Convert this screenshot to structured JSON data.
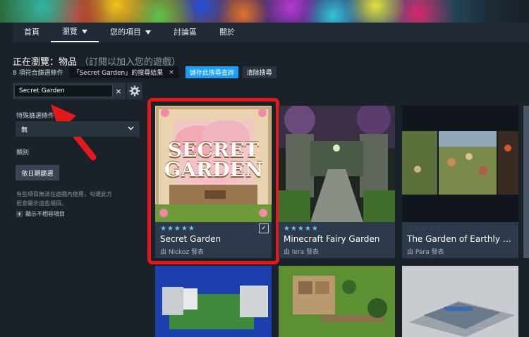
{
  "nav": {
    "items": [
      {
        "label": "首頁"
      },
      {
        "label": "瀏覽"
      },
      {
        "label": "您的項目"
      },
      {
        "label": "討論區"
      },
      {
        "label": "關於"
      }
    ]
  },
  "browse": {
    "title": "正在瀏覽：物品",
    "subtitle": "（訂閱以加入您的遊戲）"
  },
  "filters": {
    "count_text": "8 項符合篩選條件",
    "query_tag": "「Secret Garden」的搜尋結果",
    "remove_icon": "×",
    "save_label": "儲存此搜尋查詢",
    "clear_label": "清除搜尋"
  },
  "search": {
    "value": "Secret Garden",
    "clear_icon": "×"
  },
  "sidebar": {
    "special_filter_label": "特殊篩選條件",
    "special_filter_value": "無",
    "category_label": "類別",
    "date_filter_button": "依日期篩選",
    "incompatible_note": "有些項目無法在遊戲內使用，勾選此方框會顯示這些項目。",
    "show_incompatible_label": "顯示不相容項目",
    "plus_icon": "+"
  },
  "items": [
    {
      "stars": "★★★★★",
      "title": "Secret Garden",
      "author": "由 Nickoz 發表",
      "thumb_text_1": "SECRET",
      "thumb_text_2": "GARDEN",
      "check": "✓"
    },
    {
      "stars": "★★★★★",
      "title": "Minecraft Fairy Garden",
      "author": "由 lera 發表"
    },
    {
      "stars": "☆☆☆☆☆",
      "title": "The Garden of Earthly Delights",
      "author": "由 Para 發表"
    }
  ],
  "colors": {
    "accent": "#1a9fff",
    "highlight": "#e3191c",
    "star_filled": "#67c1f5",
    "background": "#1b2129"
  }
}
